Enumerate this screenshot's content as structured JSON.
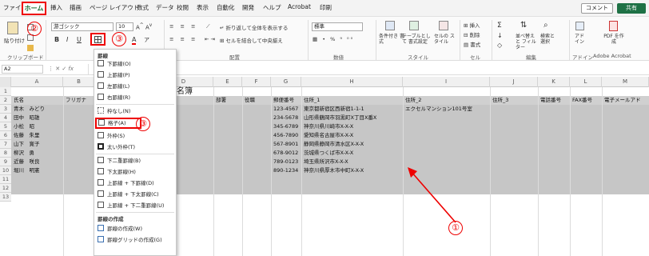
{
  "tabs": [
    "ファイル",
    "ホーム",
    "挿入",
    "描画",
    "ページ レイアウト",
    "数式",
    "データ",
    "校閲",
    "表示",
    "自動化",
    "開発",
    "ヘルプ",
    "Acrobat",
    "印刷"
  ],
  "comment_label": "コメント",
  "share_label": "共有",
  "ribbon": {
    "paste": "貼り付け",
    "clipboard": "クリップボード",
    "font_name": "游ゴシック",
    "font_size": "10",
    "wrap": "折り返して全体を表示する",
    "merge": "セルを結合して中央揃え",
    "align_group": "配置",
    "number_format": "標準",
    "number_group": "数値",
    "style_group": "スタイル",
    "cond_fmt": "条件付き 書式",
    "table_fmt": "テーブルとして 書式設定",
    "cell_style": "セルの スタイル",
    "insert": "挿入",
    "delete": "削除",
    "format": "書式",
    "cells_group": "セル",
    "sort": "並べ替えと フィルター",
    "find": "検索と 選択",
    "edit_group": "編集",
    "addin": "アド イン",
    "addin_group": "アドイン",
    "pdf": "PDF を作成",
    "acrobat_group": "Adobe Acrobat"
  },
  "name_box": "A2",
  "formula_fx": "fx",
  "columns": [
    "A",
    "B",
    "C",
    "D",
    "E",
    "F",
    "G",
    "H",
    "I",
    "J",
    "K",
    "L",
    "M"
  ],
  "sheet_title": "名簿",
  "header_row": [
    "氏名",
    "フリガナ",
    "部署",
    "役職",
    "郵便番号",
    "住所_1",
    "住所_2",
    "住所_3",
    "電話番号",
    "FAX番号",
    "電子メールアド"
  ],
  "rows": [
    {
      "n": "3",
      "name": "青木　みどり",
      "zip": "123-4567",
      "a1": "東京都新宿区西新宿1-1-1",
      "a2": "エクセルマンション101号室"
    },
    {
      "n": "4",
      "name": "田中　昭雄",
      "zip": "234-5678",
      "a1": "山形県鶴岡市羽黒町X丁目X番X",
      "a2": ""
    },
    {
      "n": "5",
      "name": "小松　昭",
      "zip": "345-6789",
      "a1": "神奈川県川崎市X-X-X",
      "a2": ""
    },
    {
      "n": "6",
      "name": "佐藤　朱里",
      "zip": "456-7890",
      "a1": "愛知県名古屋市X-X-X",
      "a2": ""
    },
    {
      "n": "7",
      "name": "山下　寛子",
      "zip": "567-8901",
      "a1": "静岡県静岡市清水区X-X-X",
      "a2": ""
    },
    {
      "n": "8",
      "name": "柳沢　勇",
      "zip": "678-9012",
      "a1": "茨城県つくば市X-X-X",
      "a2": ""
    },
    {
      "n": "9",
      "name": "近藤　咲良",
      "zip": "789-0123",
      "a1": "埼玉県所沢市X-X-X",
      "a2": ""
    },
    {
      "n": "10",
      "name": "堀川　明憲",
      "zip": "890-1234",
      "a1": "神奈川県厚木市中町X-X-X",
      "a2": ""
    }
  ],
  "row_numbers": [
    "1",
    "2",
    "3",
    "4",
    "5",
    "6",
    "7",
    "8",
    "9",
    "10",
    "11",
    "12",
    "13"
  ],
  "menu": {
    "header1": "罫線",
    "items1": [
      "下罫線(O)",
      "上罫線(P)",
      "左罫線(L)",
      "右罫線(R)"
    ],
    "items2": [
      "枠なし(N)",
      "格子(A)",
      "外枠(S)",
      "太い外枠(T)"
    ],
    "items3": [
      "下二重罫線(B)",
      "下太罫線(H)",
      "上罫線 + 下罫線(D)",
      "上罫線 + 下太罫線(C)",
      "上罫線 + 下二重罫線(U)"
    ],
    "header2": "罫線の作成",
    "items4": [
      "罫線の作成(W)",
      "罫線グリッドの作成(G)"
    ]
  },
  "annotations": [
    "①",
    "②",
    "③",
    "③"
  ],
  "colors": {
    "accent_red": "#e00000",
    "excel_green": "#1e7145",
    "selection_gray": "#c6c6c6"
  }
}
